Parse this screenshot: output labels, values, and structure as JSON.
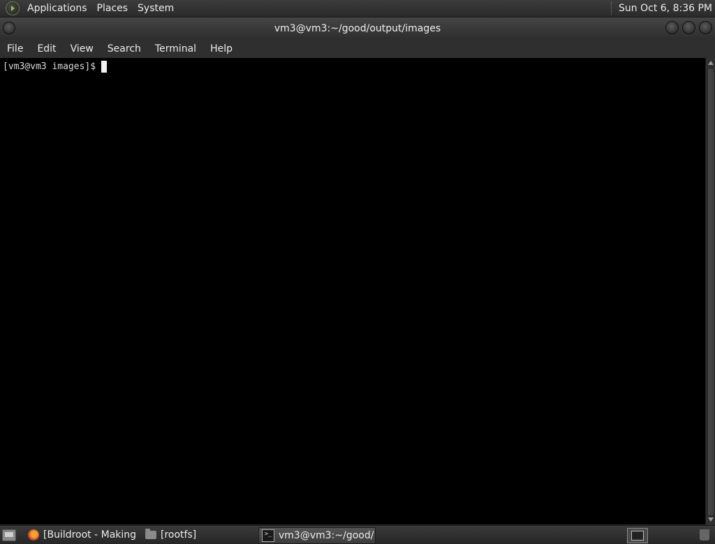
{
  "top_panel": {
    "menus": [
      "Applications",
      "Places",
      "System"
    ],
    "clock": "Sun Oct  6,  8:36 PM"
  },
  "window": {
    "title": "vm3@vm3:~/good/output/images",
    "menubar": [
      "File",
      "Edit",
      "View",
      "Search",
      "Terminal",
      "Help"
    ]
  },
  "terminal": {
    "prompt": "[vm3@vm3 images]$"
  },
  "taskbar": {
    "tasks": [
      {
        "label": "[Buildroot - Making ...",
        "icon": "firefox-icon"
      },
      {
        "label": "[rootfs]",
        "icon": "folder-icon"
      },
      {
        "label": "vm3@vm3:~/good/...",
        "icon": "terminal-icon",
        "active": true
      }
    ]
  },
  "colors": {
    "terminal_bg": "#000000",
    "panel_bg": "#2f2f2f",
    "text": "#ececec"
  }
}
